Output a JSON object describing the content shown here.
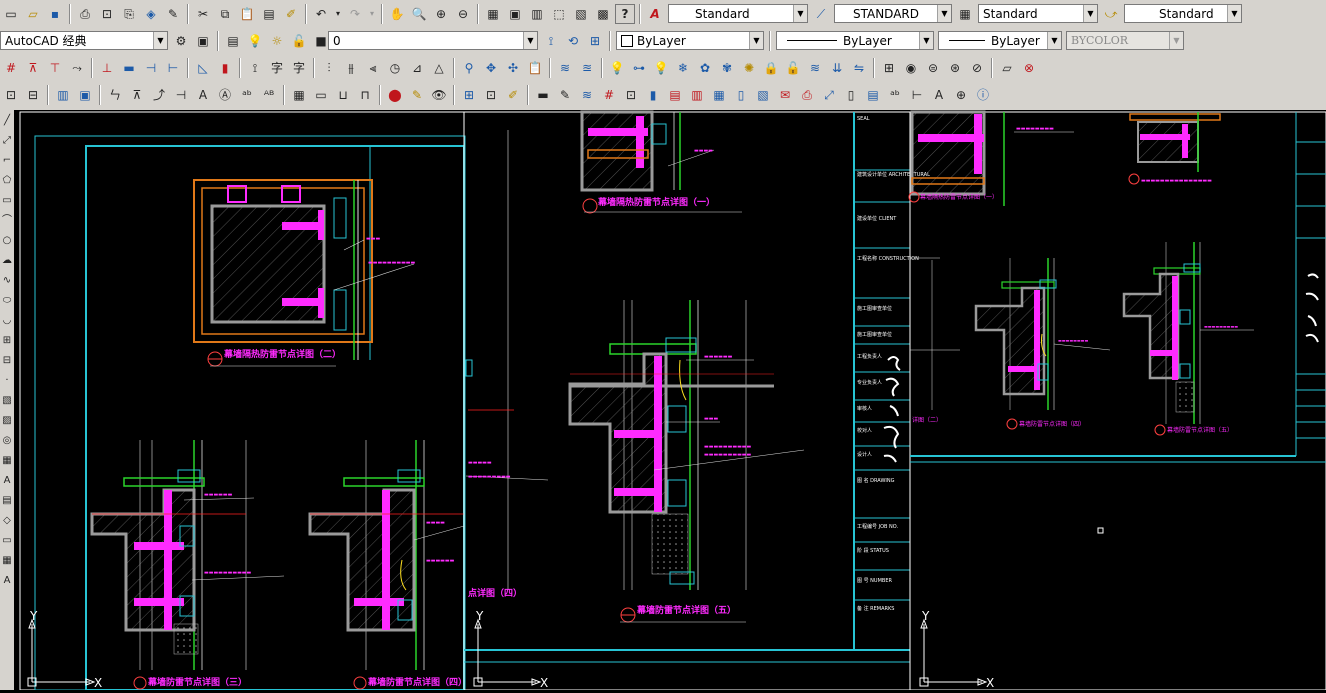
{
  "toolbar_row1": {
    "text_style": "Standard",
    "dim_style": "STANDARD",
    "table_style": "Standard",
    "multileader_style": "Standard",
    "help_icon": "?"
  },
  "toolbar_row2": {
    "workspace": "AutoCAD 经典",
    "layer": "0",
    "color": "ByLayer",
    "linetype": "ByLayer",
    "lineweight": "ByLayer",
    "plotstyle": "BYCOLOR"
  },
  "drawing": {
    "details": [
      "幕墙隔热防雷节点详图（二）",
      "幕墙防雷节点详图（三）",
      "幕墙防雷节点详图（四）",
      "幕墙隔热防雷节点详图（一）",
      "幕墙防雷节点详图（五）",
      "幕墙隔热防雷节点详图（一）",
      "幕墙防雷节点详图（四）",
      "幕墙防雷节点详图（五）"
    ],
    "partial_labels": [
      "点详图（四）",
      "详图（二）"
    ],
    "title_block": {
      "seal": "SEAL",
      "architectural": "建筑设计单位\nARCHITECTURAL",
      "client": "建设单位\nCLIENT",
      "construction": "工程名称\nCONSTRUCTION",
      "drawing": "图 名\nDRAWING",
      "job_no": "工程编号\nJOB NO.",
      "status": "阶 段\nSTATUS",
      "number": "图 号\nNUMBER",
      "remarks": "备 注\nREMARKS",
      "roles": [
        "施工图审查单位",
        "施工图审查单位",
        "工程负责人",
        "专业负责人",
        "审核人",
        "校对人",
        "设计人"
      ]
    },
    "ucs_axes": {
      "x": "X",
      "y": "Y"
    }
  }
}
